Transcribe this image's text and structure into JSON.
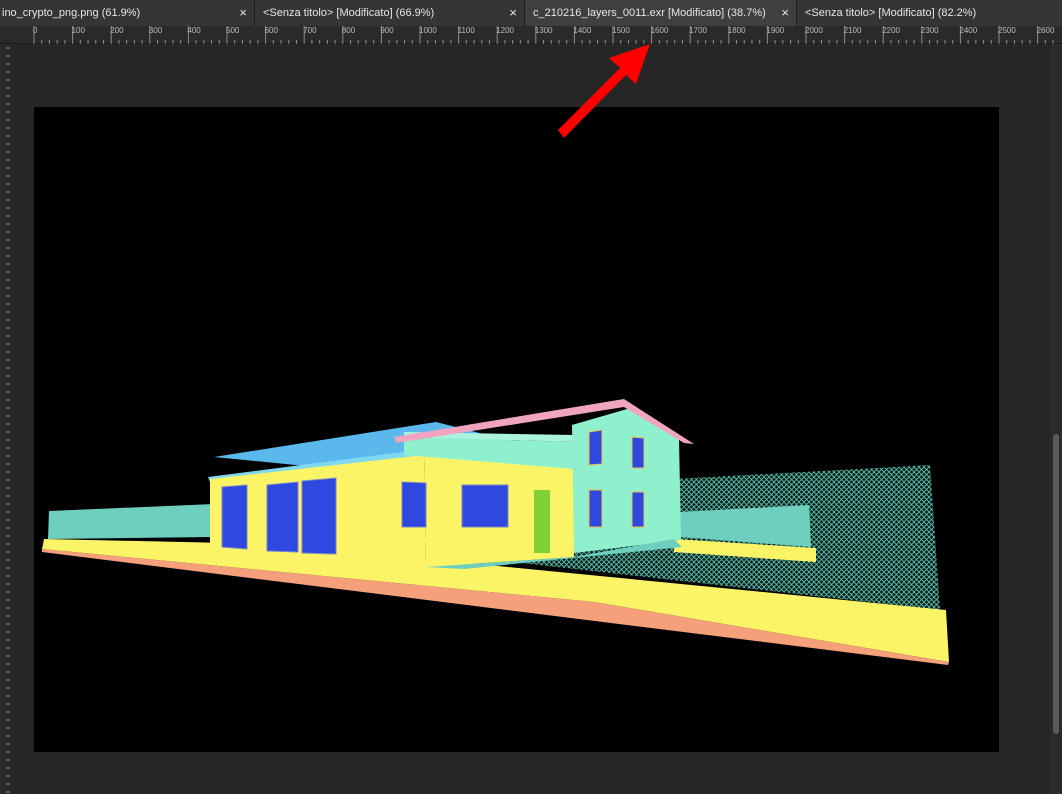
{
  "tabs": [
    {
      "label": "ino_crypto_png.png (61.9%)",
      "close": "×"
    },
    {
      "label": "<Senza titolo> [Modificato] (66.9%)",
      "close": "×"
    },
    {
      "label": "c_210216_layers_0011.exr [Modificato] (38.7%)",
      "close": "×",
      "active": true
    },
    {
      "label": "<Senza titolo> [Modificato] (82.2%)",
      "close": ""
    }
  ],
  "ruler": {
    "labels": [
      "0",
      "100",
      "200",
      "300",
      "400",
      "500",
      "600",
      "700",
      "800",
      "900",
      "1000",
      "1100",
      "1200",
      "1300",
      "1400",
      "1500",
      "1600",
      "1700",
      "1800",
      "1900",
      "2000",
      "2100",
      "2200",
      "2300",
      "2400",
      "2500",
      "2600"
    ]
  },
  "colors": {
    "annotation_arrow": "#ff0000",
    "wall_yellow": "#fbf467",
    "roof_blue": "#5ab8ec",
    "facade_mint": "#8ef0cc",
    "window_blue": "#2f48e0",
    "door_green": "#7fcf37"
  }
}
